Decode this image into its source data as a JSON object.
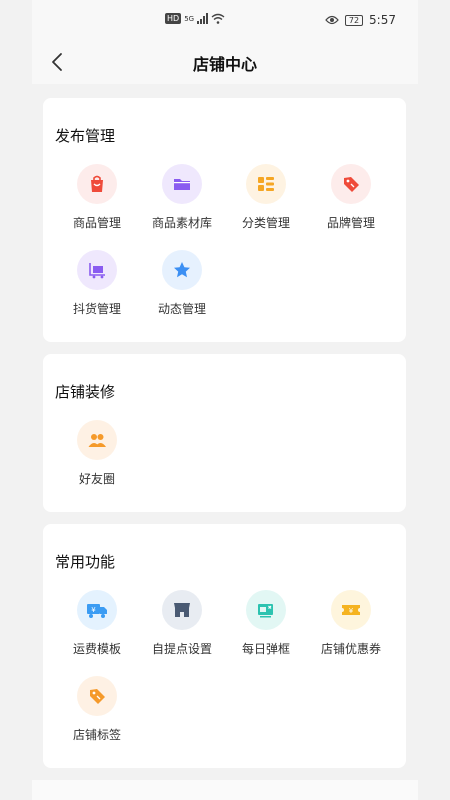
{
  "status": {
    "net": "5G",
    "battery": "72",
    "time": "5:57"
  },
  "nav": {
    "title": "店铺中心"
  },
  "sections": [
    {
      "title": "发布管理",
      "items": [
        {
          "label": "商品管理",
          "icon": "shopping-bag-icon"
        },
        {
          "label": "商品素材库",
          "icon": "folder-icon"
        },
        {
          "label": "分类管理",
          "icon": "category-list-icon"
        },
        {
          "label": "品牌管理",
          "icon": "tag-icon"
        },
        {
          "label": "抖货管理",
          "icon": "cart-icon"
        },
        {
          "label": "动态管理",
          "icon": "star-icon"
        }
      ]
    },
    {
      "title": "店铺装修",
      "items": [
        {
          "label": "好友圈",
          "icon": "friends-icon"
        }
      ]
    },
    {
      "title": "常用功能",
      "items": [
        {
          "label": "运费模板",
          "icon": "delivery-truck-icon"
        },
        {
          "label": "自提点设置",
          "icon": "store-icon"
        },
        {
          "label": "每日弹框",
          "icon": "popup-window-icon"
        },
        {
          "label": "店铺优惠券",
          "icon": "coupon-icon"
        },
        {
          "label": "店铺标签",
          "icon": "tag-icon"
        }
      ]
    }
  ],
  "colors": {
    "accent_red": "#ef4b3a",
    "accent_purple": "#8a5cf0",
    "accent_orange": "#f5a623",
    "accent_blue": "#3b8ff3",
    "accent_teal": "#2cc3b0"
  }
}
